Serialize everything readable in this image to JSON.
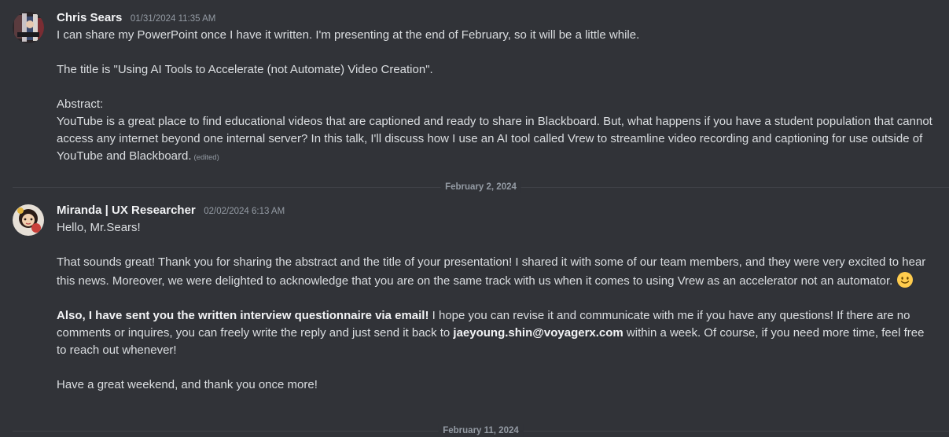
{
  "messages": [
    {
      "author": "Chris Sears",
      "timestamp": "01/31/2024 11:35 AM",
      "avatar": "avatar-chris-sears",
      "paragraphs": {
        "p1": "I can share my PowerPoint once I have it written. I'm presenting at the end of February, so it will be a little while.",
        "p2": "The title is \"Using AI Tools to Accelerate (not Automate) Video Creation\".",
        "p3": "Abstract:",
        "p4": "YouTube is a great place to find educational videos that are captioned and ready to share in Blackboard. But, what happens if you have a student population that cannot access any internet beyond one internal server? In this talk, I'll discuss how I use an AI tool called Vrew to streamline video recording and captioning for use outside of YouTube and Blackboard."
      },
      "edited_label": "(edited)"
    },
    {
      "author": "Miranda | UX Researcher",
      "timestamp": "02/02/2024 6:13 AM",
      "avatar": "avatar-miranda",
      "paragraphs": {
        "p1": "Hello, Mr.Sears!",
        "p2": "That sounds great! Thank you for sharing the abstract and the title of your presentation! I shared it with some of our team members, and they were very excited to hear this news. Moreover, we were delighted to acknowledge that you are on the same track with us when it comes to using Vrew as an accelerator not an automator.",
        "p2_emoji": "slightly-smiling-face-emoji",
        "p3_bold": "Also, I have sent you the written interview questionnaire via email!",
        "p3_a": " I hope you can revise it and communicate with me if you have any questions! If there are no comments or inquires, you can freely write the reply and just send it back to ",
        "p3_email": "jaeyoung.shin@voyagerx.com",
        "p3_b": " within a week. Of course, if you need more time, feel free to reach out whenever!",
        "p4": "Have a great weekend, and thank you once more!"
      }
    }
  ],
  "dividers": {
    "first": "February 2, 2024",
    "second": "February 11, 2024"
  },
  "colors": {
    "background": "#313338",
    "text": "#dbdee1",
    "username": "#f2f3f5",
    "muted": "#949ba4",
    "divider": "#3f4147"
  }
}
